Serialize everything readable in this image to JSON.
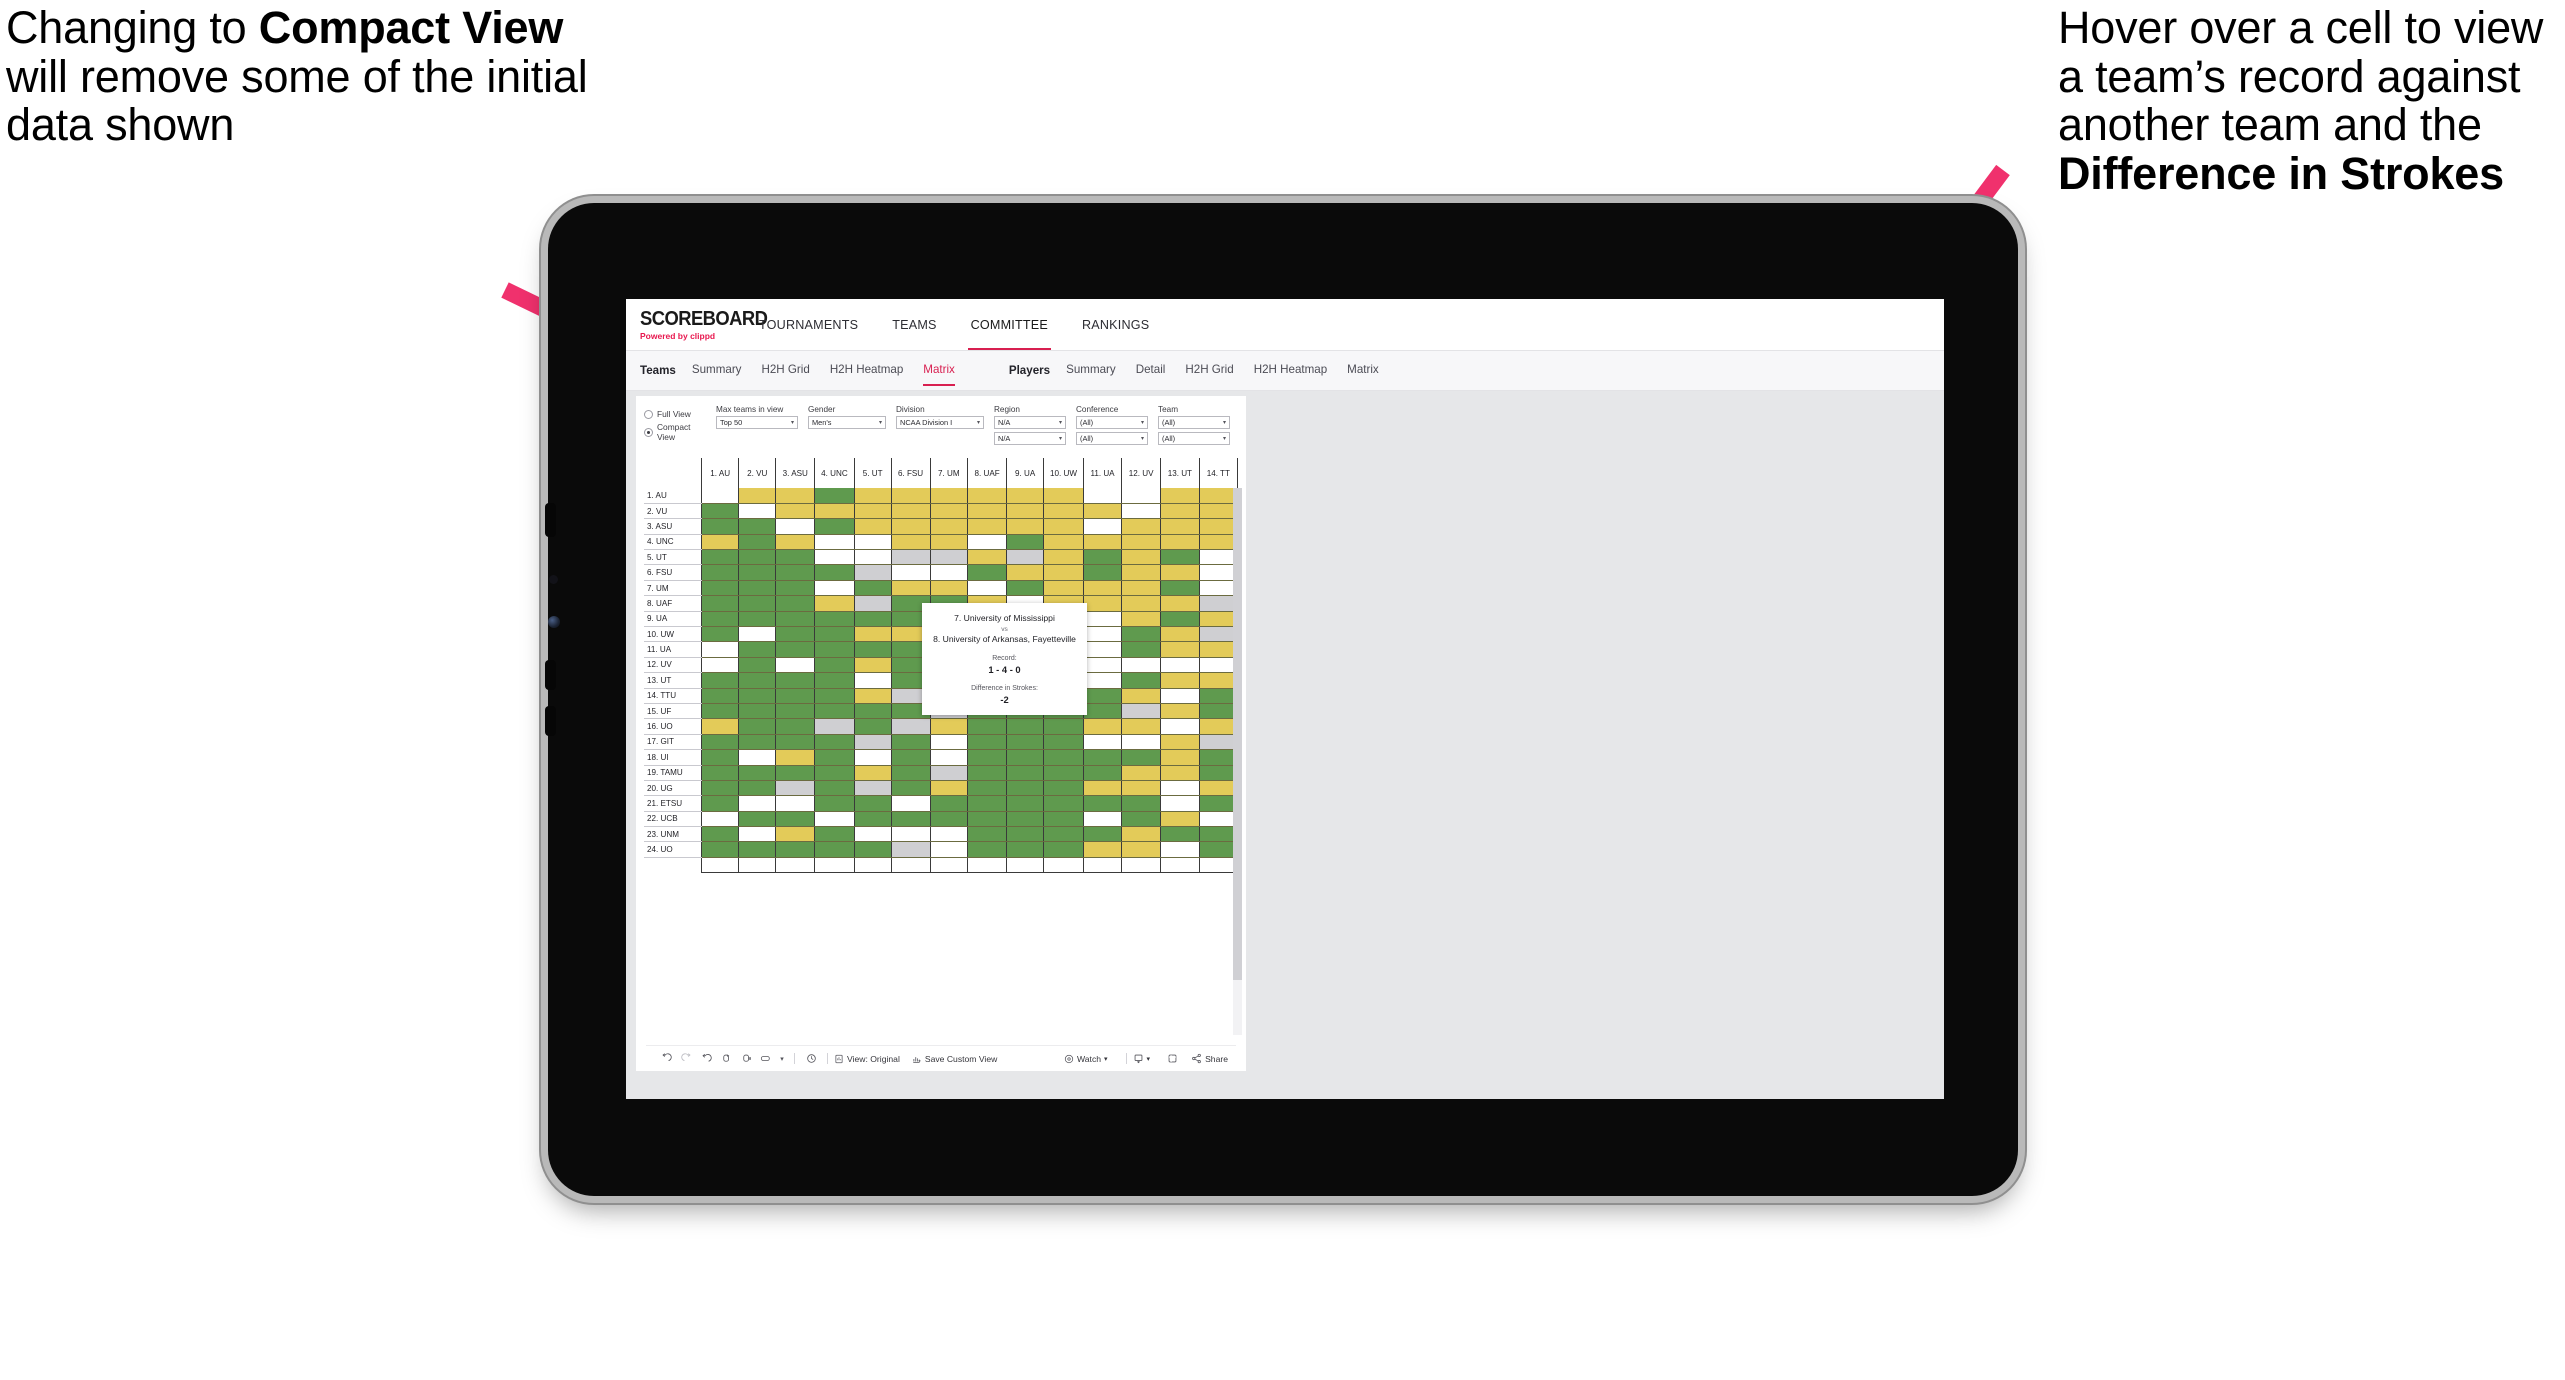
{
  "annotations": {
    "left": {
      "pre": "Changing to ",
      "bold": "Compact View",
      "post": " will remove some of the initial data shown"
    },
    "right": {
      "pre": "Hover over a cell to view a team’s record against another team and the ",
      "bold": "Difference in Strokes",
      "post": ""
    }
  },
  "colors": {
    "accent": "#d81f50",
    "arrow": "#f0316d",
    "win_green": "#5f9a4e",
    "tie_gold": "#e3cb59",
    "na_gray": "#cfcfd2",
    "loss_white": "#ffffff"
  },
  "app": {
    "brand": {
      "name": "SCOREBOARD",
      "sub_pre": "Powered by ",
      "sub_brand": "clippd"
    },
    "topnav": [
      {
        "label": "TOURNAMENTS",
        "active": false
      },
      {
        "label": "TEAMS",
        "active": false
      },
      {
        "label": "COMMITTEE",
        "active": true
      },
      {
        "label": "RANKINGS",
        "active": false
      }
    ],
    "subnav": {
      "teams_group": {
        "head": "Teams",
        "items": [
          "Summary",
          "H2H Grid",
          "H2H Heatmap",
          "Matrix"
        ],
        "active": "Matrix"
      },
      "players_group": {
        "head": "Players",
        "items": [
          "Summary",
          "Detail",
          "H2H Grid",
          "H2H Heatmap",
          "Matrix"
        ],
        "active": ""
      }
    }
  },
  "filters": {
    "view_mode": {
      "options": [
        "Full View",
        "Compact View"
      ],
      "selected": "Compact View"
    },
    "controls": [
      {
        "label": "Max teams in view",
        "value": "Top 50",
        "width": "w-max",
        "rows": 1
      },
      {
        "label": "Gender",
        "value": "Men's",
        "width": "w-gen",
        "rows": 1
      },
      {
        "label": "Division",
        "value": "NCAA Division I",
        "width": "w-div",
        "rows": 1
      },
      {
        "label": "Region",
        "value": "N/A",
        "value2": "N/A",
        "width": "w-reg",
        "rows": 2
      },
      {
        "label": "Conference",
        "value": "(All)",
        "value2": "(All)",
        "width": "w-con",
        "rows": 2
      },
      {
        "label": "Team",
        "value": "(All)",
        "value2": "(All)",
        "width": "w-team",
        "rows": 2
      }
    ]
  },
  "matrix": {
    "columns": [
      "1. AU",
      "2. VU",
      "3. ASU",
      "4. UNC",
      "5. UT",
      "6. FSU",
      "7. UM",
      "8. UAF",
      "9. UA",
      "10. UW",
      "11. UA",
      "12. UV",
      "13. UT",
      "14. TT"
    ],
    "rows": [
      "1. AU",
      "2. VU",
      "3. ASU",
      "4. UNC",
      "5. UT",
      "6. FSU",
      "7. UM",
      "8. UAF",
      "9. UA",
      "10. UW",
      "11. UA",
      "12. UV",
      "13. UT",
      "14. TTU",
      "15. UF",
      "16. UO",
      "17. GIT",
      "18. UI",
      "19. TAMU",
      "20. UG",
      "21. ETSU",
      "22. UCB",
      "23. UNM",
      "24. UO"
    ],
    "legend": {
      "g": "win",
      "y": "tie",
      "s": "no-data",
      "w": "loss"
    },
    "cells": [
      [
        "w",
        "y",
        "y",
        "g",
        "y",
        "y",
        "y",
        "y",
        "y",
        "y",
        "w",
        "w",
        "y",
        "y"
      ],
      [
        "g",
        "w",
        "y",
        "y",
        "y",
        "y",
        "y",
        "y",
        "y",
        "y",
        "y",
        "w",
        "y",
        "y"
      ],
      [
        "g",
        "g",
        "w",
        "g",
        "y",
        "y",
        "y",
        "y",
        "y",
        "y",
        "w",
        "y",
        "y",
        "y"
      ],
      [
        "y",
        "g",
        "y",
        "w",
        "w",
        "y",
        "y",
        "w",
        "g",
        "y",
        "y",
        "y",
        "y",
        "y"
      ],
      [
        "g",
        "g",
        "g",
        "w",
        "w",
        "s",
        "s",
        "y",
        "s",
        "y",
        "g",
        "y",
        "g",
        "w"
      ],
      [
        "g",
        "g",
        "g",
        "g",
        "s",
        "w",
        "w",
        "g",
        "y",
        "y",
        "g",
        "y",
        "y",
        "w"
      ],
      [
        "g",
        "g",
        "g",
        "w",
        "g",
        "y",
        "y",
        "w",
        "g",
        "y",
        "y",
        "y",
        "g",
        "w"
      ],
      [
        "g",
        "g",
        "g",
        "y",
        "s",
        "g",
        "g",
        "y",
        "w",
        "y",
        "y",
        "y",
        "y",
        "s"
      ],
      [
        "g",
        "g",
        "g",
        "g",
        "g",
        "g",
        "g",
        "g",
        "y",
        "w",
        "w",
        "y",
        "g",
        "y"
      ],
      [
        "g",
        "w",
        "g",
        "g",
        "y",
        "y",
        "y",
        "w",
        "g",
        "y",
        "w",
        "g",
        "y",
        "s"
      ],
      [
        "w",
        "g",
        "g",
        "g",
        "g",
        "g",
        "g",
        "g",
        "g",
        "g",
        "w",
        "g",
        "y",
        "y"
      ],
      [
        "w",
        "g",
        "w",
        "g",
        "y",
        "g",
        "g",
        "g",
        "g",
        "g",
        "w",
        "w",
        "w",
        "w"
      ],
      [
        "g",
        "g",
        "g",
        "g",
        "w",
        "g",
        "g",
        "g",
        "g",
        "g",
        "w",
        "g",
        "y",
        "y"
      ],
      [
        "g",
        "g",
        "g",
        "g",
        "y",
        "s",
        "y",
        "g",
        "g",
        "g",
        "g",
        "y",
        "w",
        "g"
      ],
      [
        "g",
        "g",
        "g",
        "g",
        "g",
        "g",
        "s",
        "g",
        "g",
        "g",
        "g",
        "s",
        "y",
        "g"
      ],
      [
        "y",
        "g",
        "g",
        "s",
        "g",
        "s",
        "y",
        "g",
        "g",
        "g",
        "y",
        "y",
        "w",
        "y"
      ],
      [
        "g",
        "g",
        "g",
        "g",
        "s",
        "g",
        "w",
        "g",
        "g",
        "g",
        "w",
        "w",
        "y",
        "s"
      ],
      [
        "g",
        "w",
        "y",
        "g",
        "w",
        "g",
        "w",
        "g",
        "g",
        "g",
        "g",
        "g",
        "y",
        "g"
      ],
      [
        "g",
        "g",
        "g",
        "g",
        "y",
        "g",
        "s",
        "g",
        "g",
        "g",
        "g",
        "y",
        "y",
        "g"
      ],
      [
        "g",
        "g",
        "s",
        "g",
        "s",
        "g",
        "y",
        "g",
        "g",
        "g",
        "y",
        "y",
        "w",
        "y"
      ],
      [
        "g",
        "w",
        "w",
        "g",
        "g",
        "w",
        "g",
        "g",
        "g",
        "g",
        "g",
        "g",
        "w",
        "g"
      ],
      [
        "w",
        "g",
        "g",
        "w",
        "g",
        "g",
        "g",
        "g",
        "g",
        "g",
        "w",
        "g",
        "y",
        "w"
      ],
      [
        "g",
        "w",
        "y",
        "g",
        "w",
        "w",
        "w",
        "g",
        "g",
        "g",
        "g",
        "y",
        "g",
        "g"
      ],
      [
        "g",
        "g",
        "g",
        "g",
        "g",
        "s",
        "w",
        "g",
        "g",
        "g",
        "y",
        "y",
        "w",
        "g"
      ]
    ]
  },
  "tooltip": {
    "team_a": "7. University of Mississippi",
    "vs": "vs",
    "team_b": "8. University of Arkansas, Fayetteville",
    "record_label": "Record:",
    "record_value": "1 - 4 - 0",
    "diff_label": "Difference in Strokes:",
    "diff_value": "-2"
  },
  "toolbar": {
    "icons": [
      "undo-icon",
      "redo-icon",
      "revert-icon",
      "refresh-icon",
      "pause-icon",
      "highlight-icon",
      "caret-icon"
    ],
    "buttons": [
      {
        "name": "view-original",
        "label": "View: Original",
        "icon": "view-icon"
      },
      {
        "name": "save-custom-view",
        "label": "Save Custom View",
        "icon": "save-icon"
      }
    ],
    "right_buttons": [
      {
        "name": "watch",
        "label": "Watch",
        "icon": "watch-icon",
        "caret": true
      },
      {
        "name": "download",
        "label": "",
        "icon": "download-icon",
        "caret": true
      },
      {
        "name": "fullscreen",
        "label": "",
        "icon": "fullscreen-icon",
        "caret": false
      },
      {
        "name": "share",
        "label": "Share",
        "icon": "share-icon",
        "caret": false
      }
    ]
  }
}
